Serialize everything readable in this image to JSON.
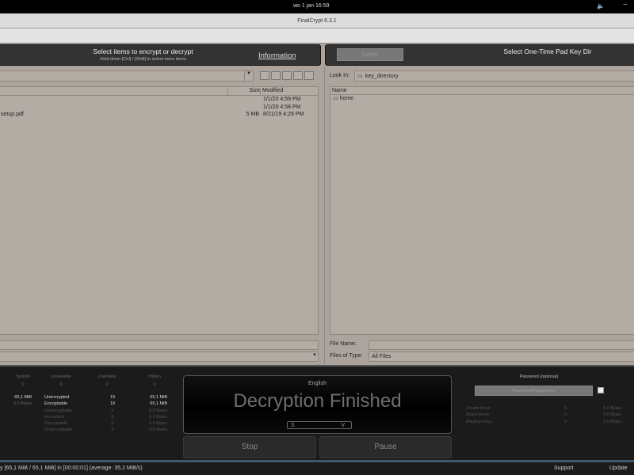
{
  "system_bar": {
    "datetime": "wo 1 jan   16:59",
    "sound_icon": "speaker-icon",
    "wifi_icon": "wifi-icon"
  },
  "window": {
    "title": "FinalCrypt 6.3.1"
  },
  "left_header": {
    "title": "Select items to encrypt or decrypt",
    "subtitle": "Hold down [Ctrl] / [Shift] to select more items",
    "info_link": "Information"
  },
  "left_browser": {
    "columns": [
      "Size",
      "Modified"
    ],
    "files": [
      {
        "name": "",
        "size": "",
        "modified": "1/1/20 4:59 PM"
      },
      {
        "name": "",
        "size": "",
        "modified": "1/1/20 4:58 PM"
      },
      {
        "name": "setup.pdf",
        "size": "5 MB",
        "modified": "8/21/19 4:29 PM"
      }
    ]
  },
  "right_header": {
    "delete_label": "Delete",
    "title": "Select One-Time Pad Key Dir"
  },
  "right_browser": {
    "look_in_label": "Look In:",
    "look_in_value": "key_directory",
    "name_col": "Name",
    "items": [
      "home"
    ],
    "file_name_label": "File Name:",
    "file_name_value": "",
    "files_of_type_label": "Files of Type:",
    "files_of_type_value": "All Files"
  },
  "stats_left": {
    "headers": [
      "Symlink",
      "Unreadable",
      "Unwritable",
      "Hidden"
    ],
    "header_values": [
      "0",
      "0",
      "0",
      "0"
    ],
    "rows": [
      {
        "size": "65,1 MiB",
        "label": "Unencrypted",
        "count": "19",
        "total": "65,1 MiB"
      },
      {
        "size": "0,0 Bytes",
        "label": "Encryptable",
        "count": "19",
        "total": "65,1 MiB"
      },
      {
        "size": "",
        "label": "Unencryptable",
        "count": "0",
        "total": "0,0 Bytes"
      },
      {
        "size": "",
        "label": "Encrypted",
        "count": "0",
        "total": "0,0 Bytes"
      },
      {
        "size": "",
        "label": "Decryptable",
        "count": "0",
        "total": "0,0 Bytes"
      },
      {
        "size": "",
        "label": "Undecryptable",
        "count": "0",
        "total": "0,0 Bytes"
      }
    ]
  },
  "center": {
    "language": "English",
    "status": "Decryption Finished",
    "slider_left": "S",
    "slider_right": "V",
    "stop_label": "Stop",
    "pause_label": "Pause"
  },
  "stats_right": {
    "password_label": "Password (optional)",
    "password_placeholder": "Password/Passphrase",
    "rows": [
      {
        "label": "Create Keys",
        "count": "0",
        "size": "0,0 Bytes"
      },
      {
        "label": "Match Keys",
        "count": "0",
        "size": "0,0 Bytes"
      },
      {
        "label": "Missing Keys",
        "count": "0",
        "size": "0,0 Bytes"
      }
    ]
  },
  "status_bar": {
    "message": "y [65,1 MiB / 65,1 MiB] in [00:00:01] (average: 35,2 MiB/s)",
    "support": "Support",
    "update": "Update"
  }
}
